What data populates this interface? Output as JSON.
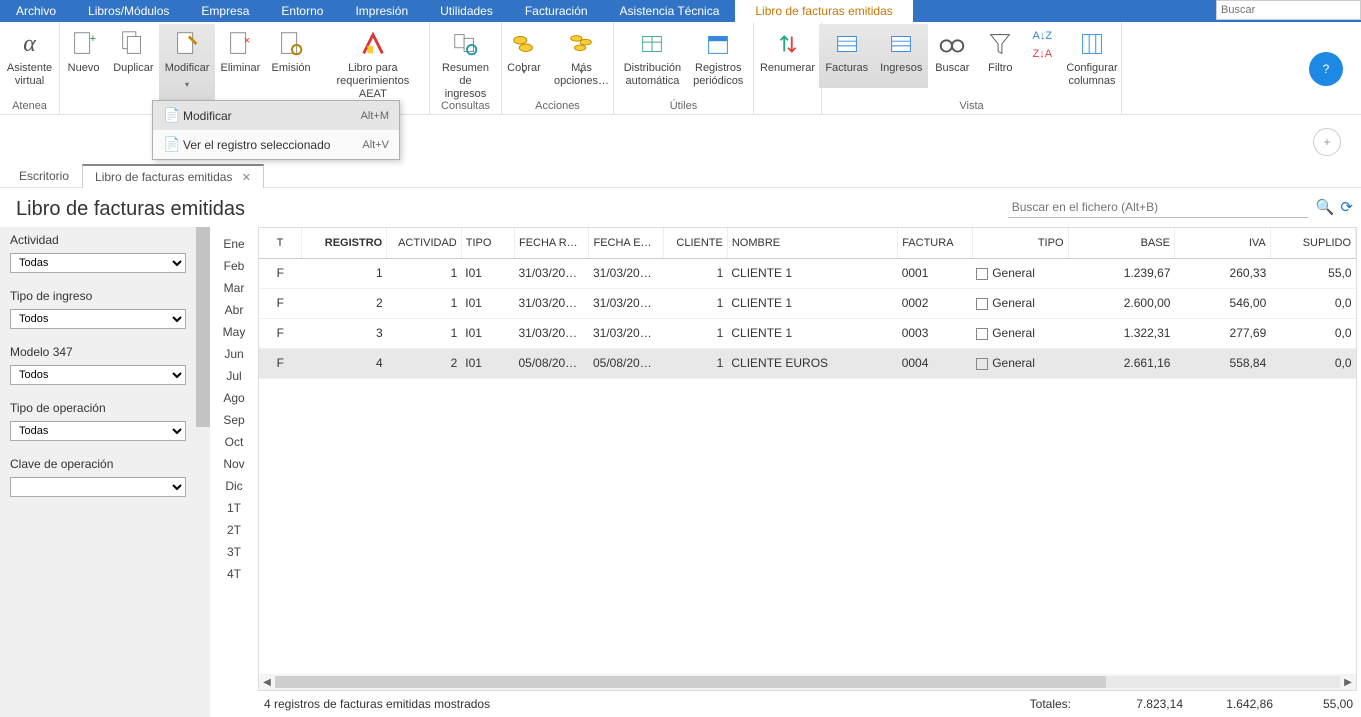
{
  "menubar": {
    "items": [
      "Archivo",
      "Libros/Módulos",
      "Empresa",
      "Entorno",
      "Impresión",
      "Utilidades",
      "Facturación",
      "Asistencia Técnica"
    ],
    "active_tab": "Libro de facturas emitidas",
    "search_placeholder": "Buscar"
  },
  "ribbon": {
    "atenea": {
      "label": "Asistente\nvirtual",
      "group": "Atenea"
    },
    "nuevo": "Nuevo",
    "duplicar": "Duplicar",
    "modificar": "Modificar",
    "eliminar": "Eliminar",
    "emision": "Emisión",
    "libro_req": "Libro para\nrequerimientos AEAT",
    "resumen": "Resumen\nde ingresos",
    "consultas_group": "Consultas",
    "cobrar": "Cobrar",
    "mas_opciones": "Más\nopciones…",
    "acciones_group": "Acciones",
    "distribucion": "Distribución\nautomática",
    "periodicos": "Registros\nperiódicos",
    "utiles_group": "Útiles",
    "renumerar": "Renumerar",
    "facturas": "Facturas",
    "ingresos": "Ingresos",
    "buscar": "Buscar",
    "filtro": "Filtro",
    "config_col": "Configurar\ncolumnas",
    "vista_group": "Vista"
  },
  "dropdown": {
    "items": [
      {
        "label": "Modificar",
        "shortcut": "Alt+M",
        "hover": true
      },
      {
        "label": "Ver el registro seleccionado",
        "shortcut": "Alt+V",
        "hover": false
      }
    ]
  },
  "doc_tabs": {
    "escritorio": "Escritorio",
    "libro": "Libro de facturas emitidas"
  },
  "page_title": "Libro de facturas emitidas",
  "filters": {
    "actividad": {
      "label": "Actividad",
      "value": "Todas"
    },
    "tipo_ingreso": {
      "label": "Tipo de ingreso",
      "value": "Todos"
    },
    "modelo347": {
      "label": "Modelo 347",
      "value": "Todos"
    },
    "tipo_operacion": {
      "label": "Tipo de operación",
      "value": "Todas"
    },
    "clave_operacion": {
      "label": "Clave de operación",
      "value": ""
    }
  },
  "months": [
    "Ene",
    "Feb",
    "Mar",
    "Abr",
    "May",
    "Jun",
    "Jul",
    "Ago",
    "Sep",
    "Oct",
    "Nov",
    "Dic",
    "1T",
    "2T",
    "3T",
    "4T"
  ],
  "search_file_placeholder": "Buscar en el fichero (Alt+B)",
  "columns": [
    "T",
    "REGISTRO",
    "ACTIVIDAD",
    "TIPO",
    "FECHA R…",
    "FECHA E…",
    "CLIENTE",
    "NOMBRE",
    "FACTURA",
    "TIPO",
    "BASE",
    "IVA",
    "SUPLIDO"
  ],
  "rows": [
    {
      "t": "F",
      "registro": "1",
      "actividad": "1",
      "tipo": "I01",
      "fecha_r": "31/03/20…",
      "fecha_e": "31/03/20…",
      "cliente": "1",
      "nombre": "CLIENTE 1",
      "factura": "0001",
      "tipo2": "General",
      "base": "1.239,67",
      "iva": "260,33",
      "suplido": "55,0",
      "sel": false
    },
    {
      "t": "F",
      "registro": "2",
      "actividad": "1",
      "tipo": "I01",
      "fecha_r": "31/03/20…",
      "fecha_e": "31/03/20…",
      "cliente": "1",
      "nombre": "CLIENTE 1",
      "factura": "0002",
      "tipo2": "General",
      "base": "2.600,00",
      "iva": "546,00",
      "suplido": "0,0",
      "sel": false
    },
    {
      "t": "F",
      "registro": "3",
      "actividad": "1",
      "tipo": "I01",
      "fecha_r": "31/03/20…",
      "fecha_e": "31/03/20…",
      "cliente": "1",
      "nombre": "CLIENTE 1",
      "factura": "0003",
      "tipo2": "General",
      "base": "1.322,31",
      "iva": "277,69",
      "suplido": "0,0",
      "sel": false
    },
    {
      "t": "F",
      "registro": "4",
      "actividad": "2",
      "tipo": "I01",
      "fecha_r": "05/08/20…",
      "fecha_e": "05/08/20…",
      "cliente": "1",
      "nombre": "CLIENTE EUROS",
      "factura": "0004",
      "tipo2": "General",
      "base": "2.661,16",
      "iva": "558,84",
      "suplido": "0,0",
      "sel": true
    }
  ],
  "status_text": "4 registros de facturas emitidas mostrados",
  "totals": {
    "label": "Totales:",
    "base": "7.823,14",
    "iva": "1.642,86",
    "suplido": "55,00"
  }
}
